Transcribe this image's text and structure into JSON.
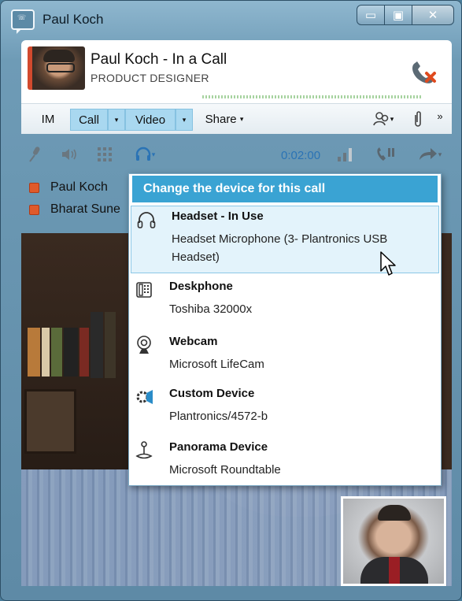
{
  "window": {
    "title": "Paul Koch",
    "buttons": {
      "minimize": "▭",
      "maximize": "▣",
      "close": "✕"
    }
  },
  "header": {
    "name_status": "Paul Koch - In a Call",
    "role": "PRODUCT DESIGNER",
    "colors": {
      "presence": "#d24a2e",
      "hangup": "#e04a1e"
    }
  },
  "toolbar": {
    "im": "IM",
    "call": "Call",
    "video": "Video",
    "share": "Share",
    "caret": "▾",
    "more": "»"
  },
  "controls": {
    "timer": "0:02:00"
  },
  "participants": [
    {
      "name": "Paul Koch"
    },
    {
      "name": "Bharat Sune"
    }
  ],
  "device_menu": {
    "header": "Change the device for this call",
    "items": [
      {
        "title": "Headset - In Use",
        "subtitle": "Headset Microphone (3- Plantronics USB Headset)",
        "icon": "headset-icon",
        "selected": true
      },
      {
        "title": "Deskphone",
        "subtitle": "Toshiba 32000x",
        "icon": "deskphone-icon"
      },
      {
        "title": "Webcam",
        "subtitle": "Microsoft LifeCam",
        "icon": "webcam-icon"
      },
      {
        "title": "Custom Device",
        "subtitle": "Plantronics/4572-b",
        "icon": "custom-device-icon"
      },
      {
        "title": "Panorama Device",
        "subtitle": "Microsoft Roundtable",
        "icon": "panorama-device-icon"
      }
    ]
  },
  "colors": {
    "accent": "#3aa3d3",
    "selected_bg": "#e3f3fb",
    "timer": "#2a73b5",
    "toolbar_highlight": "#a9d8f0"
  }
}
